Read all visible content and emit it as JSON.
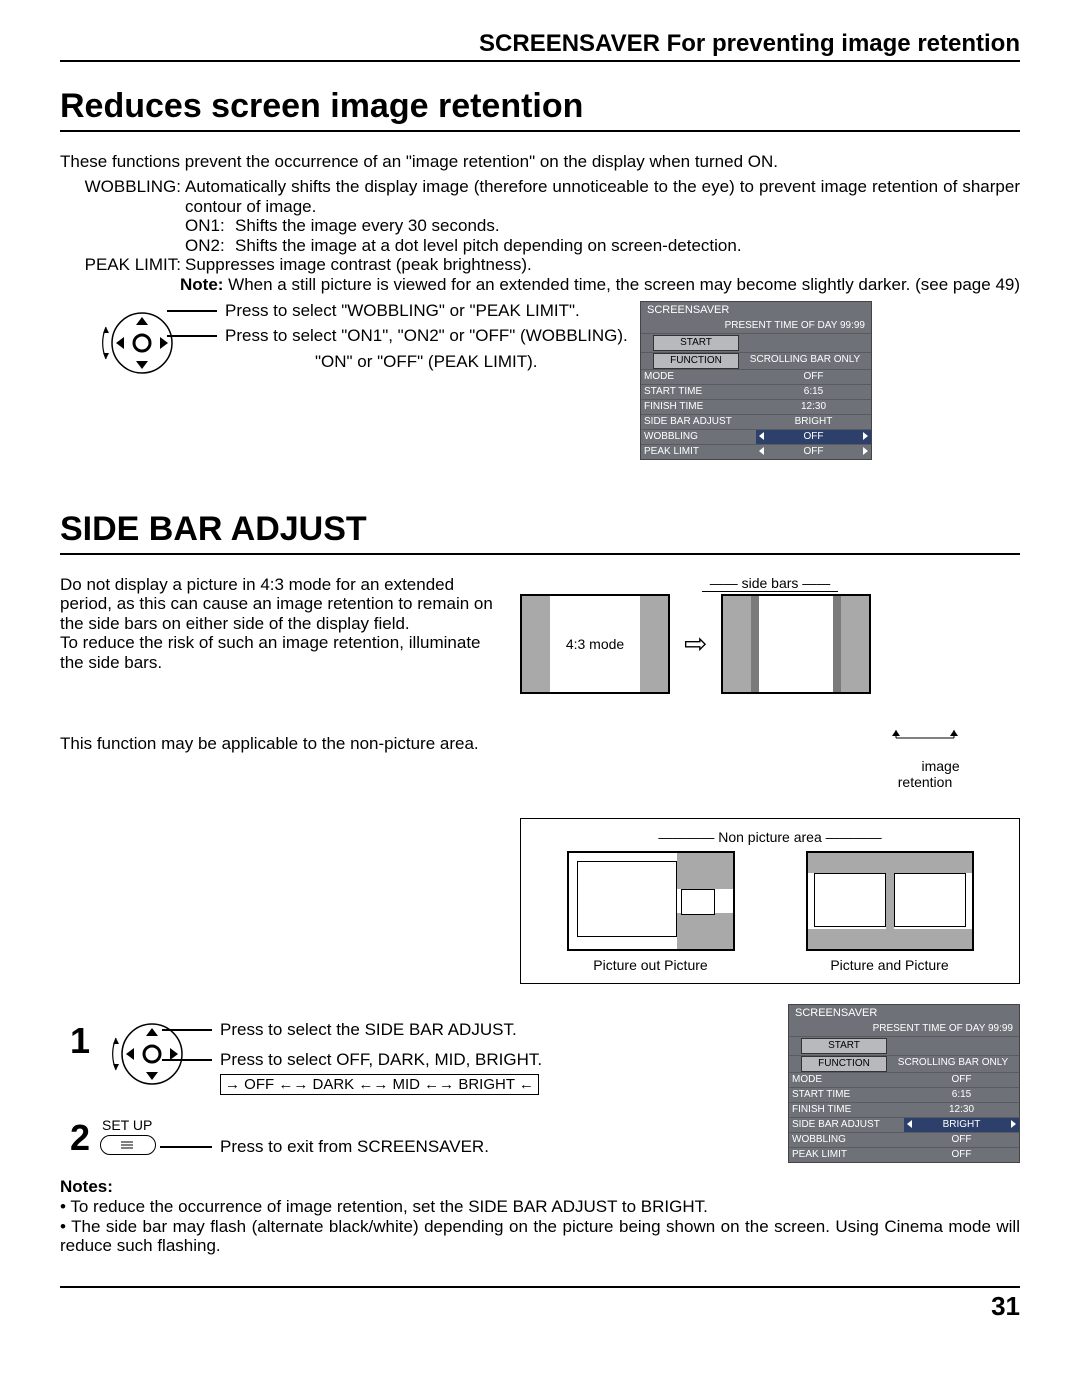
{
  "top_title": "SCREENSAVER For preventing image retention",
  "h1a": "Reduces screen image retention",
  "intro": "These functions prevent the occurrence of an \"image retention\" on the display when turned ON.",
  "wobbling": {
    "label": "WOBBLING:",
    "desc": "Automatically shifts the display image (therefore unnoticeable to the eye) to prevent image retention of sharper contour of image.",
    "on1_label": "ON1:",
    "on1_desc": "Shifts the image every 30 seconds.",
    "on2_label": "ON2:",
    "on2_desc": "Shifts the image at a dot level pitch depending on screen-detection."
  },
  "peak": {
    "label": "PEAK LIMIT:",
    "desc": "Suppresses image contrast (peak brightness)."
  },
  "note_label": "Note:",
  "note_text": " When a still picture is viewed for an extended time, the screen may become slightly darker. (see page 49)",
  "dial1_line1": "Press to select \"WOBBLING\" or \"PEAK LIMIT\".",
  "dial1_line2": "Press to select \"ON1\", \"ON2\" or \"OFF\" (WOBBLING).",
  "dial1_line3": "\"ON\" or \"OFF\" (PEAK LIMIT).",
  "osd1": {
    "title": "SCREENSAVER",
    "time": "PRESENT  TIME OF DAY    99:99",
    "rows": [
      {
        "label": "START",
        "val": ""
      },
      {
        "label": "FUNCTION",
        "val": "SCROLLING BAR ONLY"
      },
      {
        "label": "MODE",
        "val": "OFF"
      },
      {
        "label": "START TIME",
        "val": "6:15"
      },
      {
        "label": "FINISH TIME",
        "val": "12:30"
      },
      {
        "label": "SIDE BAR ADJUST",
        "val": "BRIGHT"
      },
      {
        "label": "WOBBLING",
        "val": "OFF",
        "hl": true,
        "arrows": true
      },
      {
        "label": "PEAK LIMIT",
        "val": "OFF",
        "arrows": true
      }
    ]
  },
  "h1b": "SIDE BAR ADJUST",
  "sba_p1": "Do not display a picture in 4:3 mode for an extended period, as this can cause an image retention to remain on the side bars on either side of the display field.",
  "sba_p2": "To reduce the risk of such an image retention, illuminate the side bars.",
  "sba_p3": "This function may be applicable to the non-picture area.",
  "diag": {
    "side_bars": "side bars",
    "mode43": "4:3 mode",
    "image_retention": "image\nretention",
    "non_picture_area": "Non picture area",
    "pop": "Picture out Picture",
    "pap": "Picture and Picture"
  },
  "step1": {
    "num": "1",
    "line1": "Press to select the SIDE BAR ADJUST.",
    "line2": "Press to select OFF, DARK, MID, BRIGHT.",
    "seq_items": [
      "OFF",
      "DARK",
      "MID",
      "BRIGHT"
    ]
  },
  "step2": {
    "num": "2",
    "setup": "SET UP",
    "line": "Press to exit from SCREENSAVER."
  },
  "osd2": {
    "title": "SCREENSAVER",
    "time": "PRESENT  TIME OF DAY    99:99",
    "rows": [
      {
        "label": "START",
        "val": ""
      },
      {
        "label": "FUNCTION",
        "val": "SCROLLING BAR ONLY"
      },
      {
        "label": "MODE",
        "val": "OFF"
      },
      {
        "label": "START TIME",
        "val": "6:15"
      },
      {
        "label": "FINISH TIME",
        "val": "12:30"
      },
      {
        "label": "SIDE BAR ADJUST",
        "val": "BRIGHT",
        "hl": true,
        "arrows": true
      },
      {
        "label": "WOBBLING",
        "val": "OFF"
      },
      {
        "label": "PEAK LIMIT",
        "val": "OFF"
      }
    ]
  },
  "notes_h": "Notes:",
  "notes": [
    "To reduce the occurrence of image retention, set the SIDE BAR ADJUST to BRIGHT.",
    "The side bar may flash (alternate black/white) depending on the picture being shown on the screen. Using Cinema mode will reduce such flashing."
  ],
  "page_num": "31"
}
